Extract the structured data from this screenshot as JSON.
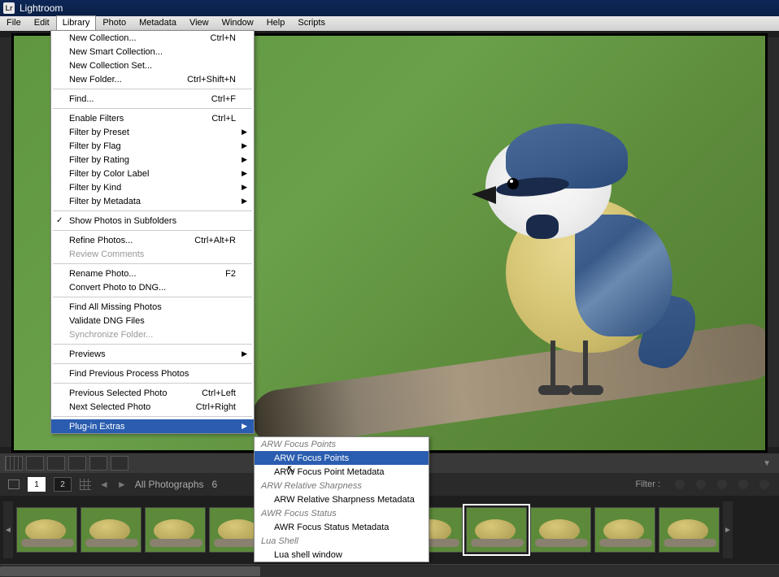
{
  "app": {
    "title": "Lightroom",
    "logo": "Lr"
  },
  "menubar": [
    "File",
    "Edit",
    "Library",
    "Photo",
    "Metadata",
    "View",
    "Window",
    "Help",
    "Scripts"
  ],
  "menubar_open_index": 2,
  "library_menu": [
    {
      "type": "item",
      "label": "New Collection...",
      "shortcut": "Ctrl+N"
    },
    {
      "type": "item",
      "label": "New Smart Collection..."
    },
    {
      "type": "item",
      "label": "New Collection Set..."
    },
    {
      "type": "item",
      "label": "New Folder...",
      "shortcut": "Ctrl+Shift+N"
    },
    {
      "type": "sep"
    },
    {
      "type": "item",
      "label": "Find...",
      "shortcut": "Ctrl+F"
    },
    {
      "type": "sep"
    },
    {
      "type": "item",
      "label": "Enable Filters",
      "shortcut": "Ctrl+L"
    },
    {
      "type": "item",
      "label": "Filter by Preset",
      "submenu": true
    },
    {
      "type": "item",
      "label": "Filter by Flag",
      "submenu": true
    },
    {
      "type": "item",
      "label": "Filter by Rating",
      "submenu": true
    },
    {
      "type": "item",
      "label": "Filter by Color Label",
      "submenu": true
    },
    {
      "type": "item",
      "label": "Filter by Kind",
      "submenu": true
    },
    {
      "type": "item",
      "label": "Filter by Metadata",
      "submenu": true
    },
    {
      "type": "sep"
    },
    {
      "type": "item",
      "label": "Show Photos in Subfolders",
      "checked": true
    },
    {
      "type": "sep"
    },
    {
      "type": "item",
      "label": "Refine Photos...",
      "shortcut": "Ctrl+Alt+R"
    },
    {
      "type": "item",
      "label": "Review Comments",
      "disabled": true
    },
    {
      "type": "sep"
    },
    {
      "type": "item",
      "label": "Rename Photo...",
      "shortcut": "F2"
    },
    {
      "type": "item",
      "label": "Convert Photo to DNG..."
    },
    {
      "type": "sep"
    },
    {
      "type": "item",
      "label": "Find All Missing Photos"
    },
    {
      "type": "item",
      "label": "Validate DNG Files"
    },
    {
      "type": "item",
      "label": "Synchronize Folder...",
      "disabled": true
    },
    {
      "type": "sep"
    },
    {
      "type": "item",
      "label": "Previews",
      "submenu": true
    },
    {
      "type": "sep"
    },
    {
      "type": "item",
      "label": "Find Previous Process Photos"
    },
    {
      "type": "sep"
    },
    {
      "type": "item",
      "label": "Previous Selected Photo",
      "shortcut": "Ctrl+Left"
    },
    {
      "type": "item",
      "label": "Next Selected Photo",
      "shortcut": "Ctrl+Right"
    },
    {
      "type": "sep"
    },
    {
      "type": "item",
      "label": "Plug-in Extras",
      "submenu": true,
      "highlight": true
    }
  ],
  "plugin_submenu": [
    {
      "type": "hdr",
      "label": "ARW Focus Points"
    },
    {
      "type": "item",
      "label": "ARW Focus Points",
      "highlight": true
    },
    {
      "type": "item",
      "label": "ARW Focus Point Metadata"
    },
    {
      "type": "hdr",
      "label": "ARW Relative Sharpness"
    },
    {
      "type": "item",
      "label": "ARW Relative Sharpness  Metadata"
    },
    {
      "type": "hdr",
      "label": "AWR Focus Status"
    },
    {
      "type": "item",
      "label": "AWR Focus Status Metadata"
    },
    {
      "type": "hdr",
      "label": "Lua Shell"
    },
    {
      "type": "item",
      "label": "Lua shell window"
    }
  ],
  "breadcrumb": {
    "page_a": "1",
    "page_b": "2",
    "source": "All Photographs",
    "count_prefix": "6",
    "filter_label": "Filter :"
  },
  "thumb_count": 11,
  "selected_thumb_index": 7
}
